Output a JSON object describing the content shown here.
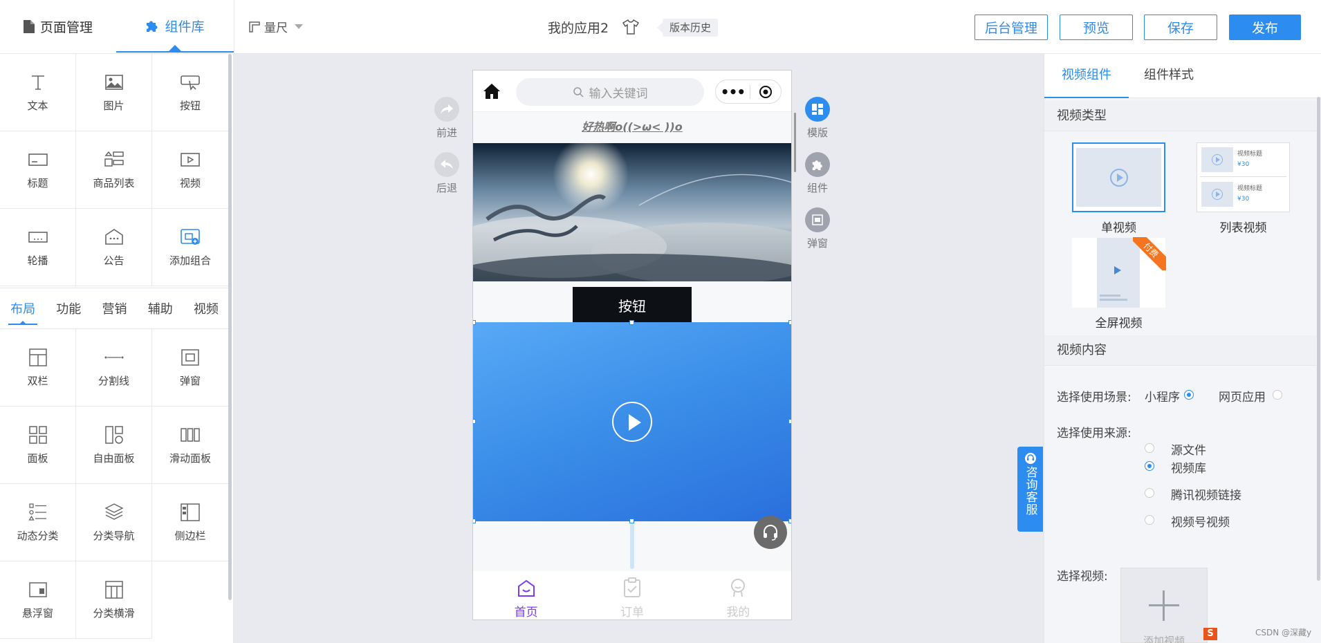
{
  "header": {
    "tabs": [
      {
        "label": "页面管理",
        "icon": "document-icon"
      },
      {
        "label": "组件库",
        "icon": "puzzle-icon"
      }
    ],
    "ruler_label": "量尺",
    "app_title": "我的应用2",
    "version_history": "版本历史",
    "buttons": {
      "admin": "后台管理",
      "preview": "预览",
      "save": "保存",
      "publish": "发布"
    }
  },
  "left_panel": {
    "basic_components": [
      {
        "label": "文本",
        "icon": "text-icon"
      },
      {
        "label": "图片",
        "icon": "image-icon"
      },
      {
        "label": "按钮",
        "icon": "button-icon"
      },
      {
        "label": "标题",
        "icon": "title-icon"
      },
      {
        "label": "商品列表",
        "icon": "product-list-icon"
      },
      {
        "label": "视频",
        "icon": "video-icon"
      },
      {
        "label": "轮播",
        "icon": "carousel-icon"
      },
      {
        "label": "公告",
        "icon": "notice-icon"
      },
      {
        "label": "添加组合",
        "icon": "add-group-icon"
      }
    ],
    "categories": [
      "布局",
      "功能",
      "营销",
      "辅助",
      "视频"
    ],
    "active_category": "布局",
    "layout_components": [
      {
        "label": "双栏",
        "icon": "two-column-icon"
      },
      {
        "label": "分割线",
        "icon": "divider-icon"
      },
      {
        "label": "弹窗",
        "icon": "popup-icon"
      },
      {
        "label": "面板",
        "icon": "panel-icon"
      },
      {
        "label": "自由面板",
        "icon": "free-panel-icon"
      },
      {
        "label": "滑动面板",
        "icon": "slide-panel-icon"
      },
      {
        "label": "动态分类",
        "icon": "dynamic-category-icon"
      },
      {
        "label": "分类导航",
        "icon": "category-nav-icon"
      },
      {
        "label": "侧边栏",
        "icon": "sidebar-icon"
      },
      {
        "label": "悬浮窗",
        "icon": "floating-window-icon"
      },
      {
        "label": "分类横滑",
        "icon": "category-swipe-icon"
      }
    ]
  },
  "canvas": {
    "side_left": [
      {
        "label": "前进",
        "icon": "forward-icon"
      },
      {
        "label": "后退",
        "icon": "back-icon"
      }
    ],
    "side_right": [
      {
        "label": "模版",
        "icon": "template-icon"
      },
      {
        "label": "组件",
        "icon": "component-icon"
      },
      {
        "label": "弹窗",
        "icon": "popup-icon"
      }
    ],
    "phone": {
      "search_placeholder": "输入关键词",
      "capsule_dots": "•••",
      "marquee_text": "好热啊o((>ω< ))o",
      "button_text": "按钮",
      "tabbar": [
        {
          "label": "首页",
          "icon": "home-tab-icon",
          "active": true
        },
        {
          "label": "订单",
          "icon": "order-tab-icon",
          "active": false
        },
        {
          "label": "我的",
          "icon": "profile-tab-icon",
          "active": false
        }
      ]
    },
    "consult_label": "咨询客服"
  },
  "right_panel": {
    "tabs": [
      "视频组件",
      "组件样式"
    ],
    "section_video_type": "视频类型",
    "video_types": [
      {
        "label": "单视频",
        "selected": true
      },
      {
        "label": "列表视频",
        "selected": false
      },
      {
        "label": "全屏视频",
        "selected": false,
        "badge": "付费"
      }
    ],
    "list_preview": {
      "title": "视频标题",
      "price": "¥30"
    },
    "section_video_content": "视频内容",
    "scene_label": "选择使用场景:",
    "scene_options": [
      {
        "label": "小程序",
        "selected": true
      },
      {
        "label": "网页应用",
        "selected": false
      }
    ],
    "source_label": "选择使用来源:",
    "source_options": [
      {
        "label": "源文件",
        "selected": false
      },
      {
        "label": "视频库",
        "selected": true
      },
      {
        "label": "腾讯视频链接",
        "selected": false
      },
      {
        "label": "视频号视频",
        "selected": false
      }
    ],
    "select_video_label": "选择视频:",
    "add_video_text": "添加视频"
  },
  "footer": {
    "watermark": "CSDN @深藏y",
    "badge": "S"
  },
  "colors": {
    "accent": "#2d8cf0",
    "tab_active": "#7a3cf0",
    "paid_badge": "#f5741f"
  }
}
